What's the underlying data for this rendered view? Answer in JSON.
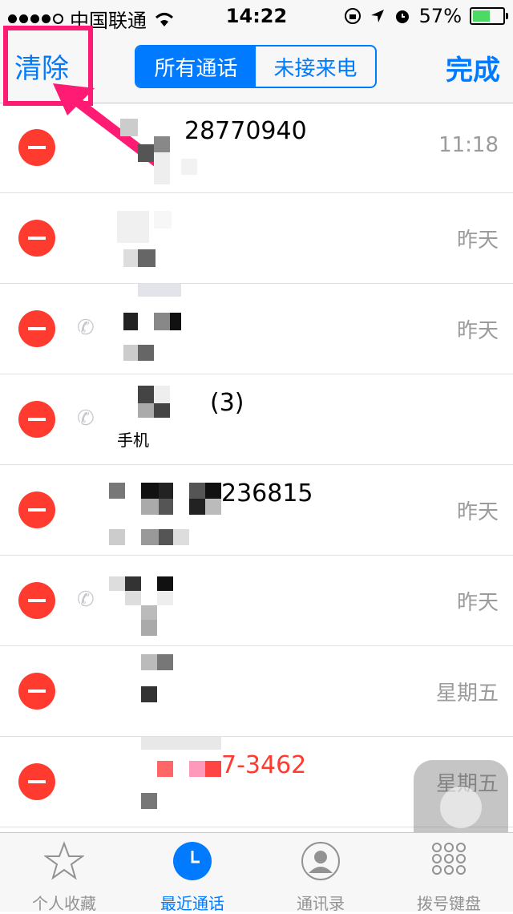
{
  "status": {
    "carrier": "中国联通",
    "time": "14:22",
    "battery": "57%",
    "battery_level": 0.57
  },
  "nav": {
    "clear_label": "清除",
    "segments": [
      {
        "label": "所有通话",
        "selected": true
      },
      {
        "label": "未接来电",
        "selected": false
      }
    ],
    "done_label": "完成"
  },
  "calls": [
    {
      "name": "28770940",
      "sub": "",
      "date": "11:18",
      "missed": false,
      "phone_icon": false
    },
    {
      "name": "",
      "sub": "",
      "date": "昨天",
      "missed": false,
      "phone_icon": false
    },
    {
      "name": "",
      "sub": "",
      "date": "昨天",
      "missed": false,
      "phone_icon": true
    },
    {
      "name": "(3)",
      "sub": "手机",
      "date": "昨天",
      "missed": false,
      "phone_icon": true
    },
    {
      "name": "236815",
      "sub": "",
      "date": "昨天",
      "missed": false,
      "phone_icon": false
    },
    {
      "name": "",
      "sub": "",
      "date": "昨天",
      "missed": false,
      "phone_icon": true
    },
    {
      "name": "",
      "sub": "",
      "date": "星期五",
      "missed": false,
      "phone_icon": false
    },
    {
      "name": "7-3462",
      "sub": "",
      "date": "星期五",
      "missed": true,
      "phone_icon": false
    }
  ],
  "tabs": [
    {
      "label": "个人收藏",
      "icon": "star-icon",
      "active": false
    },
    {
      "label": "最近通话",
      "icon": "clock-icon",
      "active": true
    },
    {
      "label": "通讯录",
      "icon": "contacts-icon",
      "active": false
    },
    {
      "label": "拨号键盘",
      "icon": "keypad-icon",
      "active": false
    }
  ],
  "colors": {
    "accent": "#007aff",
    "delete": "#ff3b30",
    "highlight": "#ff1b74"
  }
}
